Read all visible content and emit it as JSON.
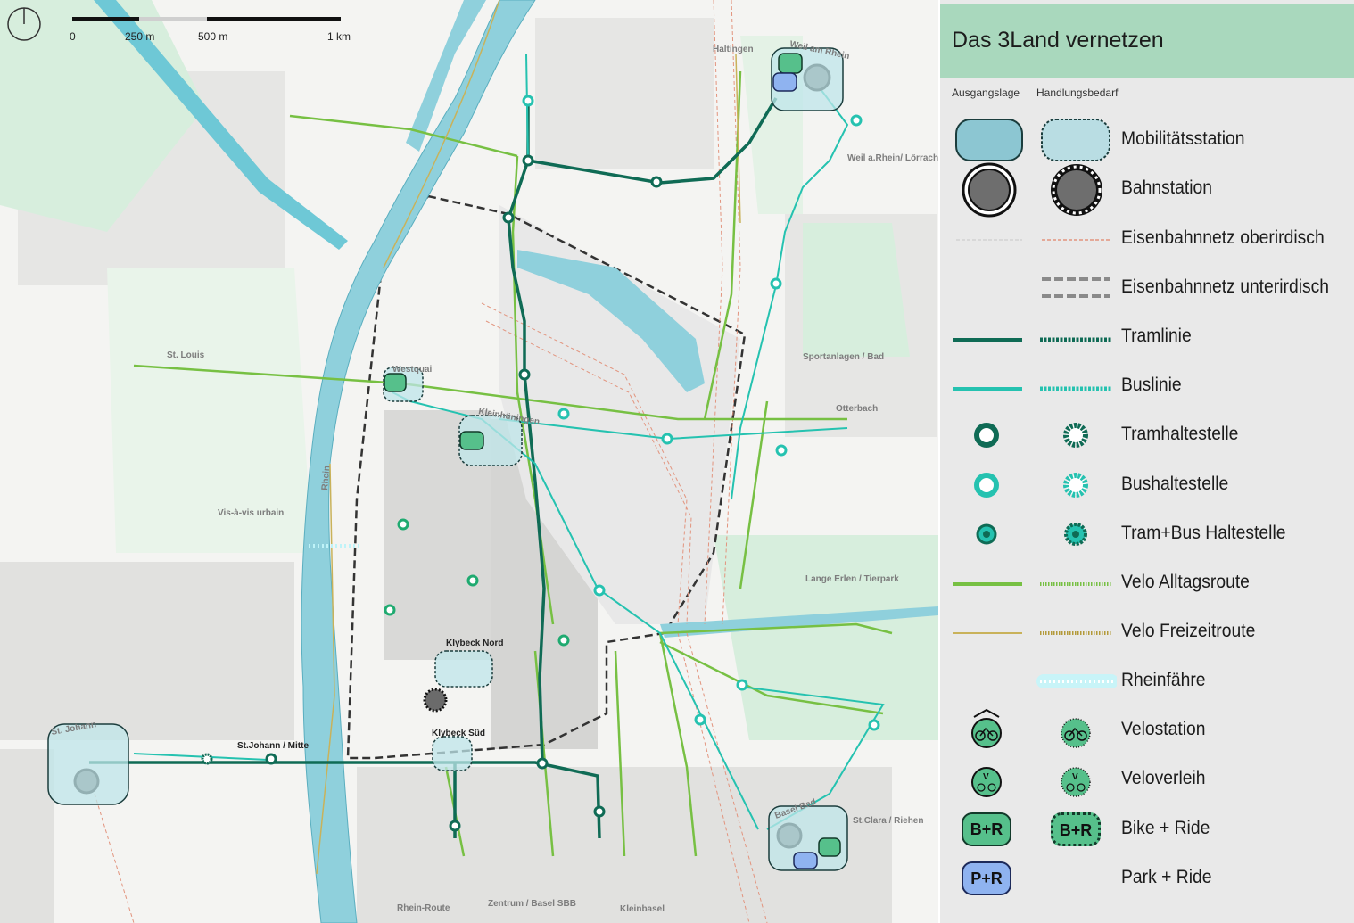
{
  "legend": {
    "title": "Das 3Land vernetzen",
    "col_existing": "Ausgangslage",
    "col_need": "Handlungsbedarf",
    "items": [
      {
        "label": "Mobilitätsstation",
        "symbol": "mobility-station"
      },
      {
        "label": "Bahnstation",
        "symbol": "rail-station"
      },
      {
        "label": "Eisenbahnnetz oberirdisch",
        "symbol": "rail-above-ground"
      },
      {
        "label": "Eisenbahnnetz unterirdisch",
        "symbol": "rail-underground"
      },
      {
        "label": "Tramlinie",
        "symbol": "tram-line"
      },
      {
        "label": "Buslinie",
        "symbol": "bus-line"
      },
      {
        "label": "Tramhaltestelle",
        "symbol": "tram-stop"
      },
      {
        "label": "Bushaltestelle",
        "symbol": "bus-stop"
      },
      {
        "label": "Tram+Bus Haltestelle",
        "symbol": "tram-bus-stop"
      },
      {
        "label": "Velo Alltagsroute",
        "symbol": "bike-commute-route"
      },
      {
        "label": "Velo Freizeitroute",
        "symbol": "bike-leisure-route"
      },
      {
        "label": "Rheinfähre",
        "symbol": "rhine-ferry"
      },
      {
        "label": "Velostation",
        "symbol": "bike-station"
      },
      {
        "label": "Veloverleih",
        "symbol": "bike-rental"
      },
      {
        "label": "Bike + Ride",
        "symbol": "bike-and-ride"
      },
      {
        "label": "Park + Ride",
        "symbol": "park-and-ride"
      }
    ],
    "badge_br": "B+R",
    "badge_pr": "P+R",
    "badge_v": "V"
  },
  "scale": {
    "labels": [
      "0",
      "250 m",
      "500 m",
      "1 km"
    ]
  },
  "map_labels": {
    "haltingen": "Haltingen",
    "weil_am_rhein": "Weil am Rhein",
    "weil_loerrach": "Weil a.Rhein/ Lörrach",
    "st_louis": "St. Louis",
    "westquai": "Westquai",
    "kleinhueningen": "Kleinhüningen",
    "sportanlagen": "Sportanlagen / Bad",
    "otterbach": "Otterbach",
    "rhein": "Rhein",
    "vis_a_vis": "Vis-à-vis urbain",
    "lange_erlen": "Lange Erlen / Tierpark",
    "klybeck_nord": "Klybeck Nord",
    "klybeck_sued": "Klybeck Süd",
    "st_johann": "St. Johann",
    "st_johann_mitte": "St.Johann / Mitte",
    "st_clara": "St.Clara / Riehen",
    "basel_bad": "Basel Bad",
    "rhein_route": "Rhein-Route",
    "zentrum": "Zentrum / Basel SBB",
    "kleinbasel": "Kleinbasel"
  },
  "colors": {
    "river": "#8fd0dc",
    "tram": "#0f6b55",
    "bus": "#25c2b0",
    "bike_commute": "#77c043",
    "bike_leisure": "#c9b25a",
    "rail": "#e2947e",
    "legend_header": "#a9d8bd"
  }
}
